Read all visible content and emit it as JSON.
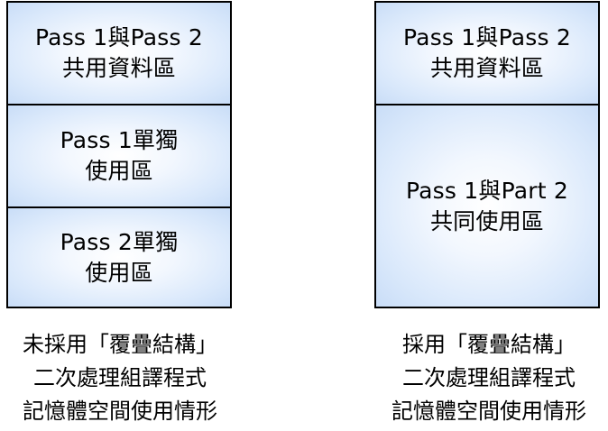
{
  "left_stack": {
    "blocks": [
      {
        "line1": "Pass 1與Pass 2",
        "line2": "共用資料區"
      },
      {
        "line1": "Pass 1單獨",
        "line2": "使用區"
      },
      {
        "line1": "Pass 2單獨",
        "line2": "使用區"
      }
    ],
    "caption": {
      "line1": "未採用「覆疊結構」",
      "line2": "二次處理組譯程式",
      "line3": "記憶體空間使用情形"
    }
  },
  "right_stack": {
    "blocks": [
      {
        "line1": "Pass 1與Pass 2",
        "line2": "共用資料區"
      },
      {
        "line1": "Pass 1與Part 2",
        "line2": "共同使用區"
      }
    ],
    "caption": {
      "line1": "採用「覆疊結構」",
      "line2": "二次處理組譯程式",
      "line3": "記憶體空間使用情形"
    }
  },
  "colors": {
    "block_fill_center": "#ffffff",
    "block_fill_edge": "#c9ddf7",
    "border": "#000000"
  }
}
